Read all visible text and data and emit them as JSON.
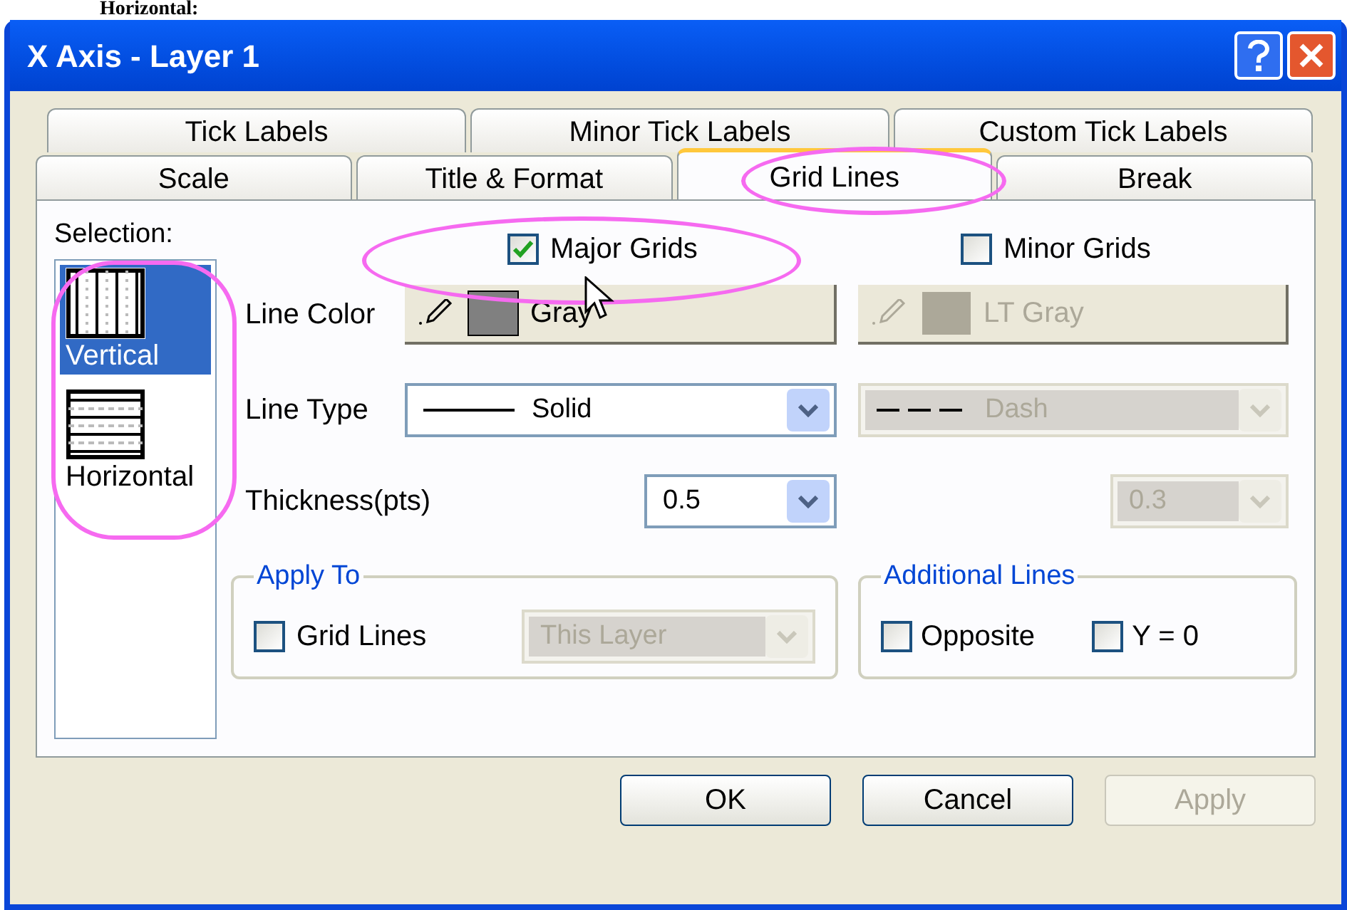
{
  "caption": "Horizontal:",
  "window": {
    "title": "X Axis - Layer 1"
  },
  "tab_rows": [
    [
      {
        "label": "Tick Labels",
        "selected": false
      },
      {
        "label": "Minor Tick Labels",
        "selected": false
      },
      {
        "label": "Custom Tick Labels",
        "selected": false
      }
    ],
    [
      {
        "label": "Scale",
        "selected": false
      },
      {
        "label": "Title & Format",
        "selected": false
      },
      {
        "label": "Grid Lines",
        "selected": true
      },
      {
        "label": "Break",
        "selected": false
      }
    ]
  ],
  "selection": {
    "label": "Selection:",
    "items": [
      {
        "label": "Vertical",
        "kind": "vertical",
        "selected": true
      },
      {
        "label": "Horizontal",
        "kind": "horizontal",
        "selected": false
      }
    ]
  },
  "grids": [
    {
      "label": "Major Grids",
      "checked": true,
      "disabled": false,
      "line_color": "Gray",
      "color": "#808080",
      "line_type": "Solid",
      "thickness": "0.5"
    },
    {
      "label": "Minor Grids",
      "checked": false,
      "disabled": true,
      "line_color": "LT Gray",
      "color": "#aca899",
      "line_type": "Dash",
      "thickness": "0.3"
    }
  ],
  "row_labels": {
    "line_color": "Line Color",
    "line_type": "Line Type",
    "thickness": "Thickness(pts)"
  },
  "apply_to": {
    "title": "Apply To",
    "checkbox": {
      "label": "Grid Lines",
      "checked": false
    },
    "scope": {
      "value": "This Layer",
      "disabled": true
    }
  },
  "additional_lines": {
    "title": "Additional Lines",
    "checkboxes": [
      {
        "label": "Opposite",
        "checked": false
      },
      {
        "label": "Y = 0",
        "checked": false
      }
    ]
  },
  "buttons": [
    {
      "label": "OK",
      "disabled": false
    },
    {
      "label": "Cancel",
      "disabled": false
    },
    {
      "label": "Apply",
      "disabled": true
    }
  ]
}
